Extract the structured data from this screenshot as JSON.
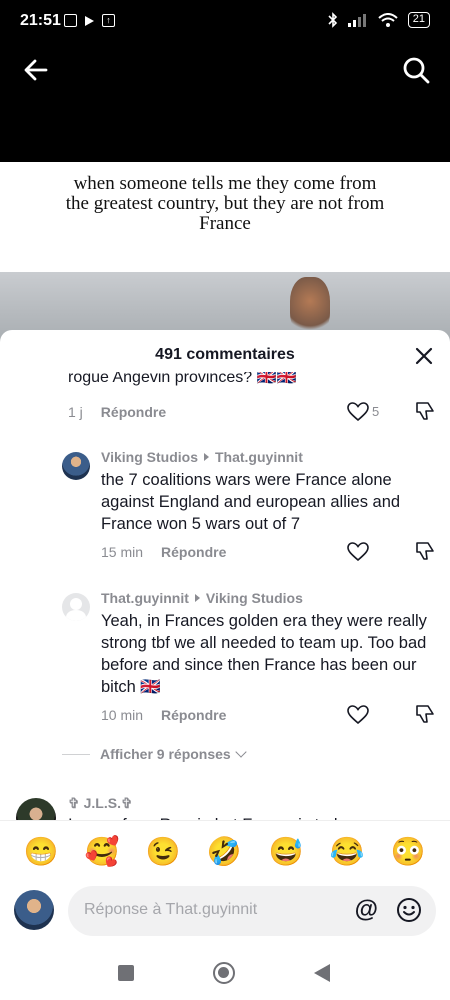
{
  "status_bar": {
    "time": "21:51",
    "battery": "21"
  },
  "video": {
    "caption": "when someone tells me they come from the greatest country, but they are not from France"
  },
  "comments_header": {
    "title": "491 commentaires"
  },
  "truncated_comment": {
    "text": "rogue Angevin provinces? 🇬🇧🇬🇧",
    "time": "1 j",
    "reply_label": "Répondre",
    "likes": "5"
  },
  "replies": [
    {
      "author": "Viking Studios",
      "reply_to": "That.guyinnit",
      "text": "the 7 coalitions wars were France alone against England and european allies and France won 5 wars out of 7",
      "time": "15 min",
      "reply_label": "Répondre"
    },
    {
      "author": "That.guyinnit",
      "reply_to": "Viking Studios",
      "text": "Yeah, in Frances golden era they were really strong tbf we all needed to team up. Too bad before and since then France has been our bitch 🇬🇧",
      "time": "10 min",
      "reply_label": "Répondre"
    }
  ],
  "more_replies": {
    "label": "Afficher 9 réponses"
  },
  "next_comment": {
    "author": "✞ J.L.S.✞",
    "text": "I come from Russia but France is truly a"
  },
  "emojis": [
    "😁",
    "🥰",
    "😉",
    "🤣",
    "😅",
    "😂",
    "😳"
  ],
  "input": {
    "placeholder": "Réponse à That.guyinnit",
    "at_symbol": "@"
  }
}
